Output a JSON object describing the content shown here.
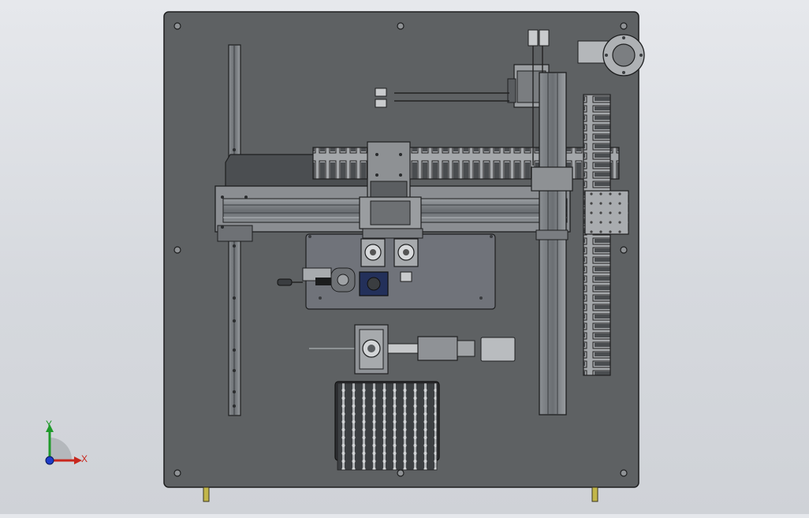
{
  "viewport": {
    "background_top": "#e6e8ec",
    "background_bottom": "#cfd2d7"
  },
  "model": {
    "plate_color": "#5e6163",
    "edge_color": "#1e1f20",
    "rail_color": "#7c8084",
    "carriage_color": "#8e9194",
    "drag_chain_color": "#a2a5a8",
    "panel_color": "#70737a",
    "feet_color": "#c2b64a"
  },
  "triad": {
    "x_label": "X",
    "y_label": "Y",
    "x_color": "#c8281e",
    "y_color": "#1f9a2a",
    "z_color": "#1e3cc8"
  }
}
